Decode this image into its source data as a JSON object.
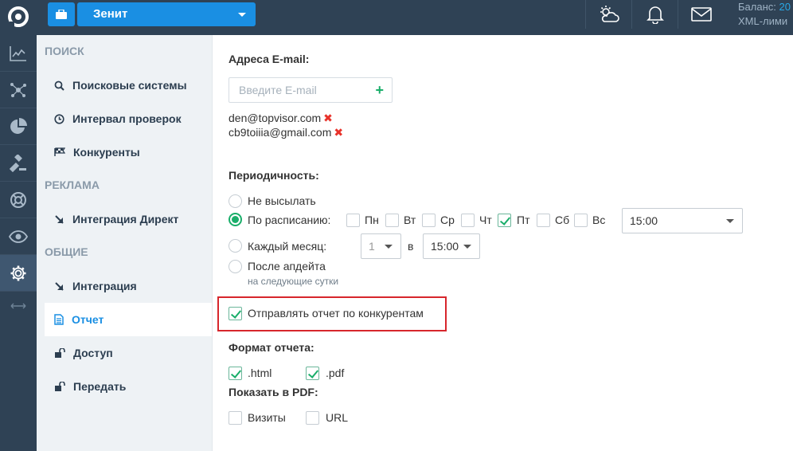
{
  "header": {
    "project_name": "Зенит",
    "balance_label": "Баланс:",
    "balance_value": "20",
    "xml_limit_label": "XML-лими",
    "colors": {
      "bar": "#2f4255",
      "accent": "#1a8fe3"
    }
  },
  "sidebar": {
    "sections": [
      {
        "title": "ПОИСК",
        "items": [
          "Поисковые системы",
          "Интервал проверок",
          "Конкуренты"
        ]
      },
      {
        "title": "РЕКЛАМА",
        "items": [
          "Интеграция Директ"
        ]
      },
      {
        "title": "ОБЩИЕ",
        "items": [
          "Интеграция",
          "Отчет",
          "Доступ",
          "Передать"
        ]
      }
    ],
    "active_item": "Отчет"
  },
  "email": {
    "label": "Адреса E-mail:",
    "placeholder": "Введите E-mail",
    "add_symbol": "+",
    "addresses": [
      "den@topvisor.com",
      "cb9toiiia@gmail.com"
    ],
    "remove_symbol": "✖"
  },
  "periodicity": {
    "label": "Периодичность:",
    "options": {
      "none": "Не высылать",
      "schedule": "По расписанию:",
      "monthly": "Каждый месяц:",
      "after_update": "После апдейта"
    },
    "selected": "schedule",
    "after_update_hint": "на следующие сутки",
    "days": [
      {
        "label": "Пн",
        "checked": false
      },
      {
        "label": "Вт",
        "checked": false
      },
      {
        "label": "Ср",
        "checked": false
      },
      {
        "label": "Чт",
        "checked": false
      },
      {
        "label": "Пт",
        "checked": true
      },
      {
        "label": "Сб",
        "checked": false
      },
      {
        "label": "Вс",
        "checked": false
      }
    ],
    "schedule_time": "15:00",
    "month_day": "1",
    "in_label": "в",
    "month_time": "15:00"
  },
  "competitors": {
    "label": "Отправлять отчет по конкурентам",
    "checked": true
  },
  "format": {
    "label": "Формат отчета:",
    "html": {
      "label": ".html",
      "checked": true
    },
    "pdf": {
      "label": ".pdf",
      "checked": true
    }
  },
  "pdf_options": {
    "label": "Показать в PDF:",
    "visits": {
      "label": "Визиты",
      "checked": false
    },
    "url": {
      "label": "URL",
      "checked": false
    }
  }
}
